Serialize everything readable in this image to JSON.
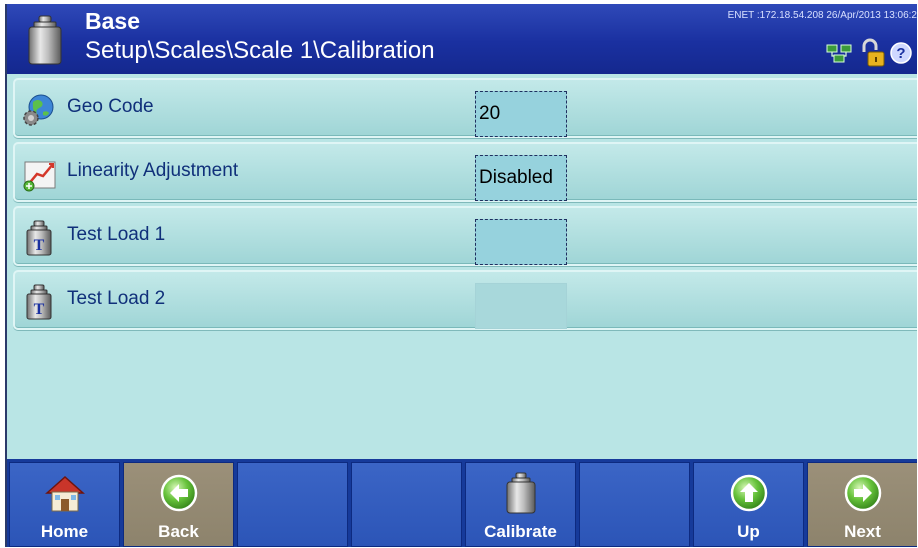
{
  "header": {
    "title": "Base",
    "path": "Setup\\Scales\\Scale 1\\Calibration",
    "network_info": "ENET :172.18.54.208  26/Apr/2013 13:06:2",
    "icons": [
      "scale-icon",
      "network-icon",
      "lock-icon",
      "help-icon"
    ]
  },
  "rows": [
    {
      "label": "Geo Code",
      "value": "20",
      "icon": "globe-gear-icon"
    },
    {
      "label": "Linearity Adjustment",
      "value": "Disabled",
      "icon": "linearity-chart-icon"
    },
    {
      "label": "Test Load 1",
      "value": "",
      "icon": "test-weight-icon"
    },
    {
      "label": "Test Load 2",
      "value": "",
      "icon": "test-weight-icon"
    }
  ],
  "softkeys": [
    {
      "label": "Home",
      "icon": "home-icon"
    },
    {
      "label": "Back",
      "icon": "back-arrow-icon"
    },
    {
      "label": "",
      "icon": ""
    },
    {
      "label": "",
      "icon": ""
    },
    {
      "label": "Calibrate",
      "icon": "calibration-weight-icon"
    },
    {
      "label": "",
      "icon": ""
    },
    {
      "label": "Up",
      "icon": "up-arrow-icon"
    },
    {
      "label": "Next",
      "icon": "next-arrow-icon"
    }
  ],
  "colors": {
    "header_bg": "#1a30a0",
    "content_bg": "#b9e5e5",
    "softkey_bg": "#2c55b7",
    "softkey_dim_bg": "#8d836c",
    "label_text": "#10307a"
  }
}
